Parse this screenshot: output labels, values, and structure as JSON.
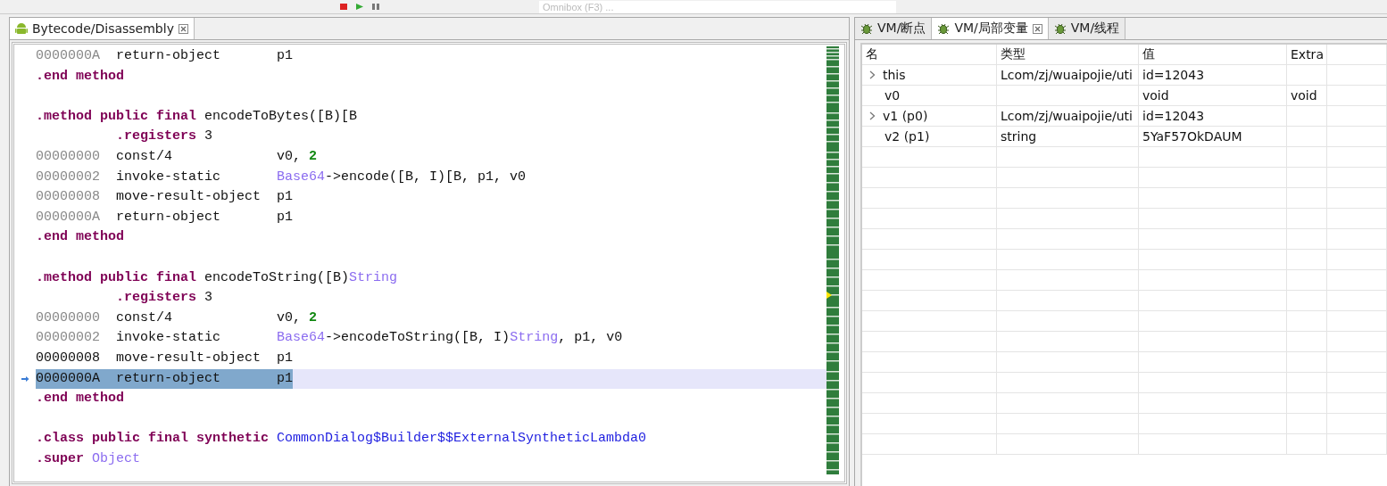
{
  "toolbar": {
    "omnibox": {
      "placeholder": "Omnibox (F3) ..."
    }
  },
  "editor": {
    "tabs": [
      {
        "label": "Bytecode/Disassembly",
        "selected": true
      }
    ],
    "lines": [
      {
        "kind": "code",
        "current": false,
        "segments": [
          {
            "kind": "addr",
            "text": "0000000A"
          },
          {
            "kind": "plain",
            "text": "  return-object       p1"
          }
        ]
      },
      {
        "kind": "code",
        "current": false,
        "segments": [
          {
            "kind": "keyword",
            "text": ".end method"
          }
        ]
      },
      {
        "kind": "blank",
        "current": false
      },
      {
        "kind": "code",
        "current": false,
        "segments": [
          {
            "kind": "keyword",
            "text": ".method public final"
          },
          {
            "kind": "plain",
            "text": " encodeToBytes([B)[B"
          }
        ]
      },
      {
        "kind": "indented",
        "current": false,
        "segments": [
          {
            "kind": "keyword",
            "text": ".registers"
          },
          {
            "kind": "plain",
            "text": " 3"
          }
        ]
      },
      {
        "kind": "code",
        "current": false,
        "segments": [
          {
            "kind": "addr",
            "text": "00000000"
          },
          {
            "kind": "plain",
            "text": "  const/4             v0, "
          },
          {
            "kind": "number",
            "text": "2"
          }
        ]
      },
      {
        "kind": "code",
        "current": false,
        "segments": [
          {
            "kind": "addr",
            "text": "00000002"
          },
          {
            "kind": "plain",
            "text": "  invoke-static       "
          },
          {
            "kind": "type",
            "text": "Base64"
          },
          {
            "kind": "plain",
            "text": "->encode([B, I)[B, p1, v0"
          }
        ]
      },
      {
        "kind": "code",
        "current": false,
        "segments": [
          {
            "kind": "addr",
            "text": "00000008"
          },
          {
            "kind": "plain",
            "text": "  move-result-object  p1"
          }
        ]
      },
      {
        "kind": "code",
        "current": false,
        "segments": [
          {
            "kind": "addr",
            "text": "0000000A"
          },
          {
            "kind": "plain",
            "text": "  return-object       p1"
          }
        ]
      },
      {
        "kind": "code",
        "current": false,
        "segments": [
          {
            "kind": "keyword",
            "text": ".end method"
          }
        ]
      },
      {
        "kind": "blank",
        "current": false
      },
      {
        "kind": "code",
        "current": false,
        "segments": [
          {
            "kind": "keyword",
            "text": ".method public final"
          },
          {
            "kind": "plain",
            "text": " encodeToString([B)"
          },
          {
            "kind": "type",
            "text": "String"
          }
        ]
      },
      {
        "kind": "indented",
        "current": false,
        "segments": [
          {
            "kind": "keyword",
            "text": ".registers"
          },
          {
            "kind": "plain",
            "text": " 3"
          }
        ]
      },
      {
        "kind": "code",
        "current": false,
        "segments": [
          {
            "kind": "addr",
            "text": "00000000"
          },
          {
            "kind": "plain",
            "text": "  const/4             v0, "
          },
          {
            "kind": "number",
            "text": "2"
          }
        ]
      },
      {
        "kind": "code",
        "current": false,
        "segments": [
          {
            "kind": "addr",
            "text": "00000002"
          },
          {
            "kind": "plain",
            "text": "  invoke-static       "
          },
          {
            "kind": "type",
            "text": "Base64"
          },
          {
            "kind": "plain",
            "text": "->encodeToString([B, I)"
          },
          {
            "kind": "type",
            "text": "String"
          },
          {
            "kind": "plain",
            "text": ", p1, v0"
          }
        ]
      },
      {
        "kind": "code",
        "current": false,
        "segments": [
          {
            "kind": "plain",
            "text": "00000008  move-result-object  p1"
          }
        ]
      },
      {
        "kind": "code",
        "current": true,
        "segments": [
          {
            "kind": "plain",
            "text": "0000000A  return-object       p1"
          }
        ]
      },
      {
        "kind": "code",
        "current": false,
        "segments": [
          {
            "kind": "keyword",
            "text": ".end method"
          }
        ]
      },
      {
        "kind": "blank",
        "current": false
      },
      {
        "kind": "code",
        "current": false,
        "segments": [
          {
            "kind": "keyword",
            "text": ".class public final synthetic"
          },
          {
            "kind": "classname",
            "text": "CommonDialog$Builder$$ExternalSyntheticLambda0"
          }
        ]
      },
      {
        "kind": "code",
        "current": false,
        "segments": [
          {
            "kind": "keyword",
            "text": ".super"
          },
          {
            "kind": "type",
            "text": "Object"
          }
        ]
      }
    ]
  },
  "debug": {
    "tabs": [
      {
        "label": "VM/断点",
        "selected": false
      },
      {
        "label": "VM/局部变量",
        "selected": true
      },
      {
        "label": "VM/线程",
        "selected": false
      }
    ],
    "table": {
      "columns": [
        "名",
        "类型",
        "值",
        "Extra"
      ],
      "rows": [
        {
          "expandable": true,
          "cells": [
            "this",
            "Lcom/zj/wuaipojie/uti",
            "id=12043",
            ""
          ]
        },
        {
          "expandable": false,
          "cells": [
            "v0",
            "",
            "void",
            "void"
          ]
        },
        {
          "expandable": true,
          "cells": [
            "v1 (p0)",
            "Lcom/zj/wuaipojie/uti",
            "id=12043",
            ""
          ]
        },
        {
          "expandable": false,
          "cells": [
            "v2 (p1)",
            "string",
            "5YaF57OkDAUM",
            ""
          ]
        }
      ]
    }
  }
}
